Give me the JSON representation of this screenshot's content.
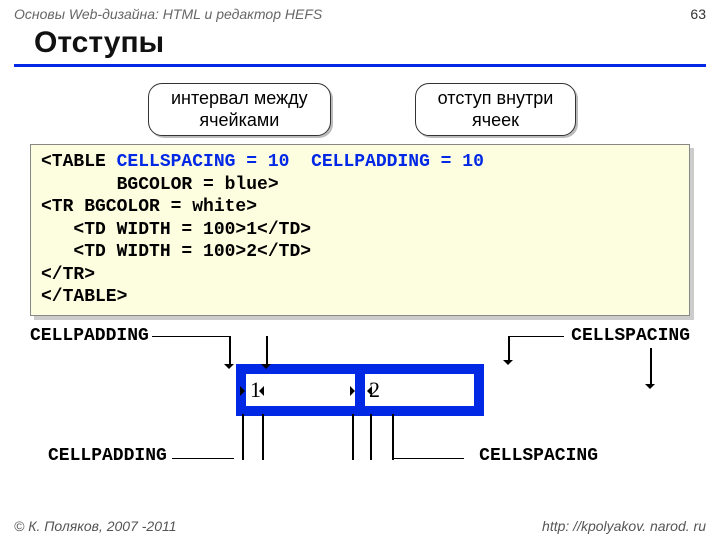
{
  "header": {
    "left": "Основы Web-дизайна: HTML и редактор HEFS",
    "page": "63"
  },
  "title": "Отступы",
  "bubbles": {
    "left": "интервал между\nячейками",
    "right": "отступ внутри\nячеек"
  },
  "code": {
    "l1a": "<TABLE ",
    "l1b": "CELLSPACING = 10",
    "l1c": "  ",
    "l1d": "CELLPADDING = 10",
    "l2": "       BGCOLOR = blue>",
    "l3": "<TR BGCOLOR = white>",
    "l4": "   <TD WIDTH = 100>1</TD>",
    "l5": "   <TD WIDTH = 100>2</TD>",
    "l6": "</TR>",
    "l7": "</TABLE>"
  },
  "diagram": {
    "cp1": "CELLPADDING",
    "cs1": "CELLSPACING",
    "cp2": "CELLPADDING",
    "cs2": "CELLSPACING",
    "cell1": "1",
    "cell2": "2"
  },
  "footer": {
    "left": "© К. Поляков, 2007 -2011",
    "right": "http: //kpolyakov. narod. ru"
  }
}
